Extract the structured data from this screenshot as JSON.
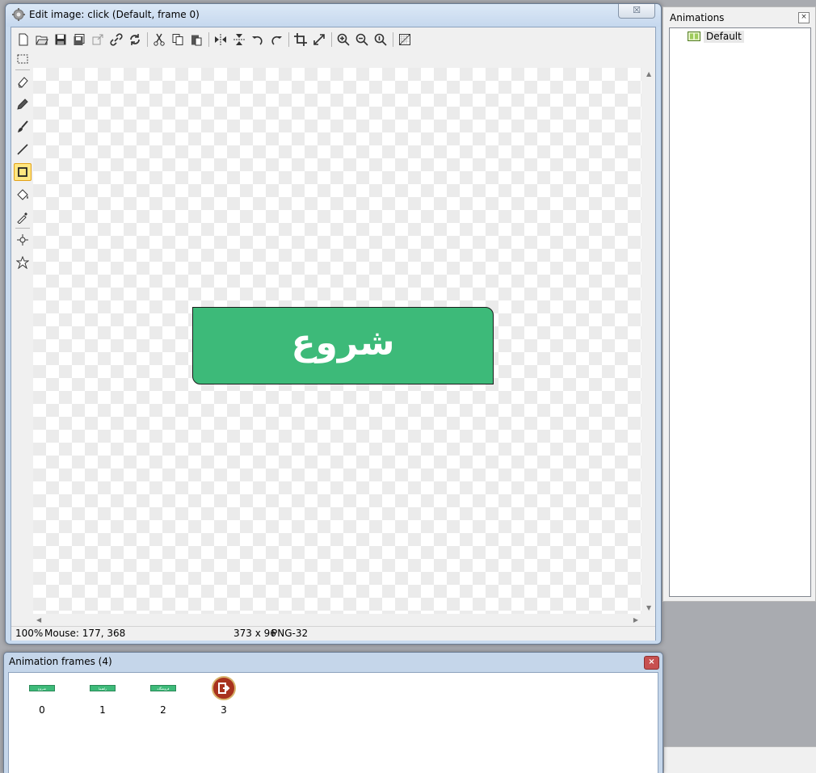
{
  "editor": {
    "title": "Edit image: click (Default, frame 0)",
    "close_label": "☒",
    "canvas_text": "شروع",
    "status": {
      "zoom": "100%",
      "mouse": "Mouse: 177, 368",
      "dimensions": "373 x 96",
      "format": "PNG-32"
    },
    "toolbar_icons": [
      "new-icon",
      "open-icon",
      "save-icon",
      "save-as-icon",
      "export-icon",
      "link-icon",
      "refresh-icon",
      "cut-icon",
      "copy-icon",
      "paste-icon",
      "flip-horizontal-icon",
      "flip-vertical-icon",
      "rotate-left-icon",
      "rotate-right-icon",
      "crop-icon",
      "resize-icon",
      "zoom-in-icon",
      "zoom-out-icon",
      "zoom-actual-icon",
      "grid-icon"
    ],
    "tools": [
      "select-rect-tool",
      "eraser-tool",
      "pencil-tool",
      "brush-tool",
      "line-tool",
      "rectangle-tool",
      "fill-tool",
      "eyedropper-tool",
      "origin-tool",
      "action-point-tool"
    ],
    "active_tool": "rectangle-tool",
    "button_color": "#3dba79"
  },
  "animations": {
    "title": "Animations",
    "items": [
      {
        "label": "Default"
      }
    ]
  },
  "frames": {
    "title": "Animation frames (4)",
    "items": [
      {
        "index": "0",
        "thumb_text": "شروع"
      },
      {
        "index": "1",
        "thumb_text": "راهنما"
      },
      {
        "index": "2",
        "thumb_text": "فروشگاه"
      },
      {
        "index": "3",
        "thumb_text": ""
      }
    ]
  }
}
